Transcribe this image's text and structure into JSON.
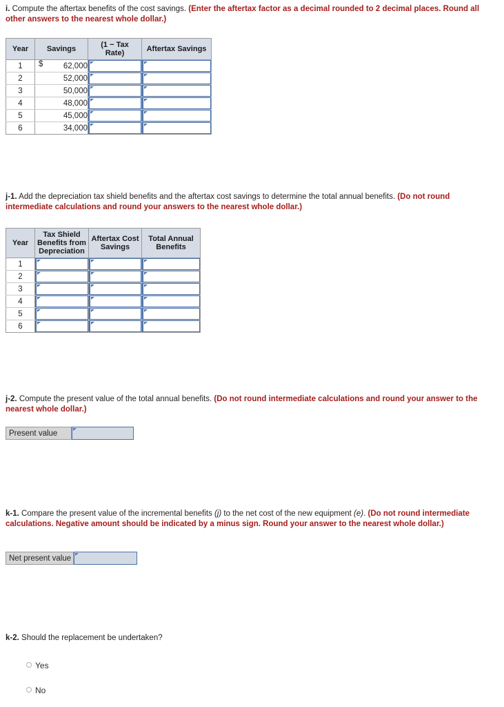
{
  "sections": {
    "i": {
      "label": "i.",
      "text": " Compute the aftertax benefits of the cost savings. ",
      "instruction": "(Enter the aftertax factor as a decimal rounded to 2 decimal places. Round all other answers to the nearest whole dollar.)"
    },
    "j1": {
      "label": "j-1.",
      "text": " Add the depreciation tax shield benefits and the aftertax cost savings to determine the total annual benefits. ",
      "instruction": "(Do not round intermediate calculations and round your answers to the nearest whole dollar.)"
    },
    "j2": {
      "label": "j-2.",
      "text": " Compute the present value of the total annual benefits. ",
      "instruction": "(Do not round intermediate calculations and round your answer to the nearest whole dollar.)"
    },
    "k1": {
      "label": "k-1.",
      "text_a": " Compare the present value of the incremental benefits ",
      "ref_j": "(j)",
      "text_b": " to the net cost of the new equipment ",
      "ref_e": "(e)",
      "text_c": ". ",
      "instruction": "(Do not round intermediate calculations. Negative amount should be indicated by a minus sign. Round your answer to the nearest whole dollar.)"
    },
    "k2": {
      "label": "k-2.",
      "text": " Should the replacement be undertaken?"
    }
  },
  "table_aftertax_savings": {
    "headers": [
      "Year",
      "Savings",
      "(1 − Tax Rate)",
      "Aftertax Savings"
    ],
    "rows": [
      {
        "year": "1",
        "currency": "$",
        "savings": "62,000",
        "tax_rate": "",
        "aftertax": ""
      },
      {
        "year": "2",
        "currency": "",
        "savings": "52,000",
        "tax_rate": "",
        "aftertax": ""
      },
      {
        "year": "3",
        "currency": "",
        "savings": "50,000",
        "tax_rate": "",
        "aftertax": ""
      },
      {
        "year": "4",
        "currency": "",
        "savings": "48,000",
        "tax_rate": "",
        "aftertax": ""
      },
      {
        "year": "5",
        "currency": "",
        "savings": "45,000",
        "tax_rate": "",
        "aftertax": ""
      },
      {
        "year": "6",
        "currency": "",
        "savings": "34,000",
        "tax_rate": "",
        "aftertax": ""
      }
    ]
  },
  "table_total_benefits": {
    "headers": [
      "Year",
      "Tax Shield Benefits from Depreciation",
      "Aftertax Cost Savings",
      "Total Annual Benefits"
    ],
    "rows": [
      {
        "year": "1",
        "tax_shield": "",
        "aftertax_cost": "",
        "total": ""
      },
      {
        "year": "2",
        "tax_shield": "",
        "aftertax_cost": "",
        "total": ""
      },
      {
        "year": "3",
        "tax_shield": "",
        "aftertax_cost": "",
        "total": ""
      },
      {
        "year": "4",
        "tax_shield": "",
        "aftertax_cost": "",
        "total": ""
      },
      {
        "year": "5",
        "tax_shield": "",
        "aftertax_cost": "",
        "total": ""
      },
      {
        "year": "6",
        "tax_shield": "",
        "aftertax_cost": "",
        "total": ""
      }
    ]
  },
  "present_value_row": {
    "label": "Present value",
    "value": ""
  },
  "net_present_value_row": {
    "label": "Net present value",
    "value": ""
  },
  "radio_options": [
    {
      "label": "Yes",
      "selected": false
    },
    {
      "label": "No",
      "selected": false
    }
  ],
  "colors": {
    "instruction_red": "#a41f1c",
    "header_fill": "#d5dce6",
    "input_border_blue": "#4a72ad",
    "answer_input_fill": "#d3dae3",
    "answer_label_fill": "#d6d6d6",
    "table_border": "#9a9a9a"
  }
}
